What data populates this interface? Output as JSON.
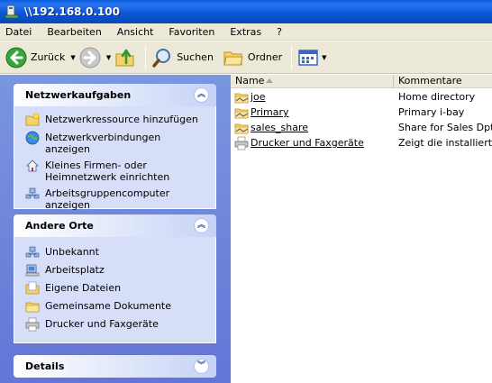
{
  "window": {
    "title": "\\\\192.168.0.100"
  },
  "menu": [
    "Datei",
    "Bearbeiten",
    "Ansicht",
    "Favoriten",
    "Extras",
    "?"
  ],
  "toolbar": {
    "back_label": "Zurück",
    "search_label": "Suchen",
    "folders_label": "Ordner"
  },
  "panels": {
    "network_tasks": {
      "title": "Netzwerkaufgaben",
      "items": [
        {
          "label": "Netzwerkressource hinzufügen",
          "icon": "add-network-place-icon"
        },
        {
          "label": "Netzwerkverbindungen anzeigen",
          "icon": "network-connections-icon"
        },
        {
          "label": "Kleines Firmen- oder Heimnetzwerk einrichten",
          "icon": "home-network-icon"
        },
        {
          "label": "Arbeitsgruppencomputer anzeigen",
          "icon": "workgroup-computers-icon"
        }
      ]
    },
    "other_places": {
      "title": "Andere Orte",
      "items": [
        {
          "label": "Unbekannt",
          "icon": "network-icon"
        },
        {
          "label": "Arbeitsplatz",
          "icon": "my-computer-icon"
        },
        {
          "label": "Eigene Dateien",
          "icon": "my-documents-icon"
        },
        {
          "label": "Gemeinsame Dokumente",
          "icon": "shared-folder-icon"
        },
        {
          "label": "Drucker und Faxgeräte",
          "icon": "printer-icon"
        }
      ]
    },
    "details": {
      "title": "Details"
    }
  },
  "filelist": {
    "columns": [
      "Name",
      "Kommentare"
    ],
    "rows": [
      {
        "name": "joe",
        "comment": "Home directory",
        "icon": "share-folder-icon"
      },
      {
        "name": "Primary",
        "comment": "Primary i-bay",
        "icon": "share-folder-icon"
      },
      {
        "name": "sales_share",
        "comment": "Share for Sales Dpt.",
        "icon": "share-folder-icon"
      },
      {
        "name": "Drucker und Faxgeräte",
        "comment": "Zeigt die installierten D",
        "icon": "printer-icon"
      }
    ]
  }
}
